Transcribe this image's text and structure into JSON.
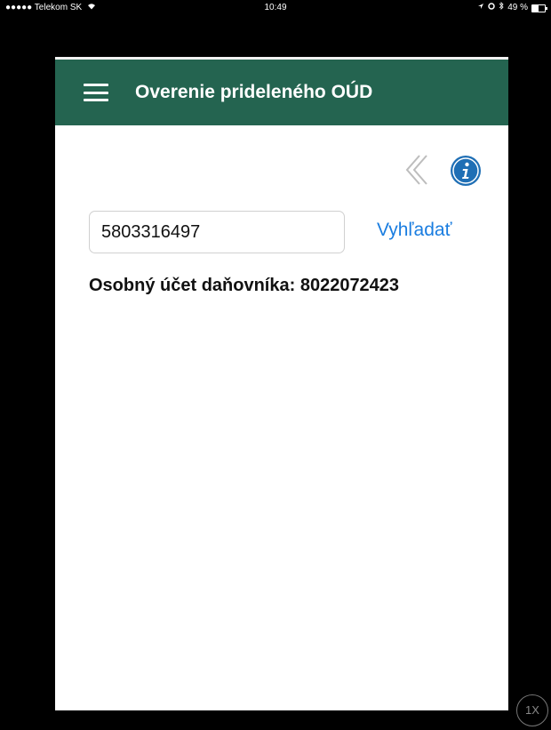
{
  "status_bar": {
    "carrier": "●●●●● Telekom SK",
    "time": "10:49",
    "battery_text": "49 %",
    "battery_level": 0.49
  },
  "app_bar": {
    "title": "Overenie prideleného OÚD"
  },
  "search": {
    "value": "5803316497",
    "button_label": "Vyhľadať"
  },
  "result": {
    "text": "Osobný účet daňovníka: 8022072423"
  },
  "zoom_badge": {
    "label": "1X"
  },
  "colors": {
    "app_bar_bg": "#246450",
    "link_blue": "#1a7de0",
    "info_icon_blue": "#1f6fb5"
  },
  "icons": {
    "menu": "hamburger-icon",
    "back": "chevron-left-double-icon",
    "info": "info-icon"
  }
}
